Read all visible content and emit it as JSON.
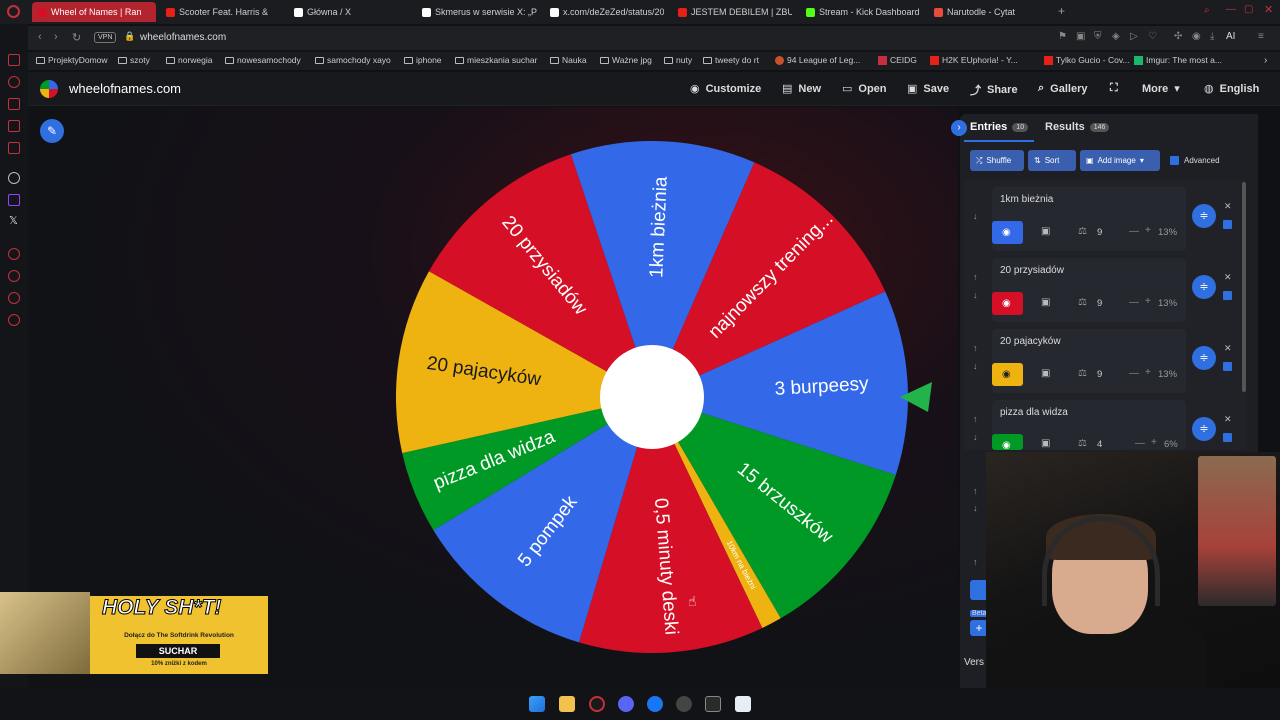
{
  "browser": {
    "tabs": [
      {
        "title": "Wheel of Names | Ran",
        "active": true,
        "favicon_color": "#d50f25"
      },
      {
        "title": "Scooter Feat. Harris &",
        "active": false,
        "favicon_color": "#e62117"
      },
      {
        "title": "Główna / X",
        "active": false,
        "favicon_color": "#ffffff"
      },
      {
        "title": "Skmerus w serwisie X: „P",
        "active": false,
        "favicon_color": "#ffffff"
      },
      {
        "title": "x.com/deZeZed/status/20",
        "active": false,
        "favicon_color": "#ffffff"
      },
      {
        "title": "JESTEM DEBILEM | ZBUD",
        "active": false,
        "favicon_color": "#e62117"
      },
      {
        "title": "Stream - Kick Dashboard",
        "active": false,
        "favicon_color": "#53fc18"
      },
      {
        "title": "Narutodle - Cytat",
        "active": false,
        "favicon_color": "#e84c3d"
      }
    ],
    "vpn_label": "VPN",
    "url": "wheelofnames.com",
    "ai_label": "AI",
    "bookmarks": [
      "ProjektyDomow",
      "szoty",
      "norwegia",
      "nowesamochody",
      "samochody xayo",
      "iphone",
      "mieszkania suchar",
      "Nauka",
      "Ważne jpg",
      "nuty",
      "tweety do rt",
      "94 League of Leg...",
      "CEIDG",
      "H2K EUphoria! - Y...",
      "Tylko Gucio - Cov...",
      "Imgur: The most a..."
    ]
  },
  "site": {
    "title": "wheelofnames.com",
    "menu": [
      {
        "label": "Customize",
        "icon": "palette-icon"
      },
      {
        "label": "New",
        "icon": "file-icon"
      },
      {
        "label": "Open",
        "icon": "folder-open-icon"
      },
      {
        "label": "Save",
        "icon": "save-icon"
      },
      {
        "label": "Share",
        "icon": "share-icon"
      },
      {
        "label": "Gallery",
        "icon": "search-icon"
      },
      {
        "label": "More",
        "icon": "chevron-down-icon"
      },
      {
        "label": "English",
        "icon": "globe-icon"
      }
    ]
  },
  "wheel": {
    "segments": [
      {
        "label": "1km bieżnia",
        "color": "#3369e8",
        "weight": 9
      },
      {
        "label": "najnowszy trening...",
        "color": "#d50f25",
        "weight": 9
      },
      {
        "label": "3 burpeesy",
        "color": "#3369e8",
        "weight": 9
      },
      {
        "label": "15 brzuszków",
        "color": "#009925",
        "weight": 9
      },
      {
        "label": "10km na bieżni",
        "color": "#eeb211",
        "weight": 1
      },
      {
        "label": "0,5 minuty deski",
        "color": "#d50f25",
        "weight": 9
      },
      {
        "label": "5 pompek",
        "color": "#3369e8",
        "weight": 9
      },
      {
        "label": "pizza dla widza",
        "color": "#009925",
        "weight": 4
      },
      {
        "label": "20 pajacyków",
        "color": "#eeb211",
        "weight": 9
      },
      {
        "label": "20 przysiadów",
        "color": "#d50f25",
        "weight": 9
      }
    ]
  },
  "panel": {
    "entries_tab": "Entries",
    "entries_count": "10",
    "results_tab": "Results",
    "results_count": "146",
    "shuffle": "Shuffle",
    "sort": "Sort",
    "add_image": "Add image",
    "advanced": "Advanced",
    "beta": "Beta",
    "version": "Vers",
    "entries": [
      {
        "name": "1km bieżnia",
        "weight": "9",
        "percent": "13%",
        "color": "#3369e8"
      },
      {
        "name": "20 przysiadów",
        "weight": "9",
        "percent": "13%",
        "color": "#d50f25"
      },
      {
        "name": "20 pajacyków",
        "weight": "9",
        "percent": "13%",
        "color": "#eeb211"
      },
      {
        "name": "pizza dla widza",
        "weight": "4",
        "percent": "6%",
        "color": "#009925"
      }
    ]
  },
  "promo": {
    "title": "HOLY SH*T!",
    "subtitle": "Dołącz do The Softdrink Revolution",
    "code": "SUCHAR",
    "discount": "10% zniżki z kodem"
  }
}
